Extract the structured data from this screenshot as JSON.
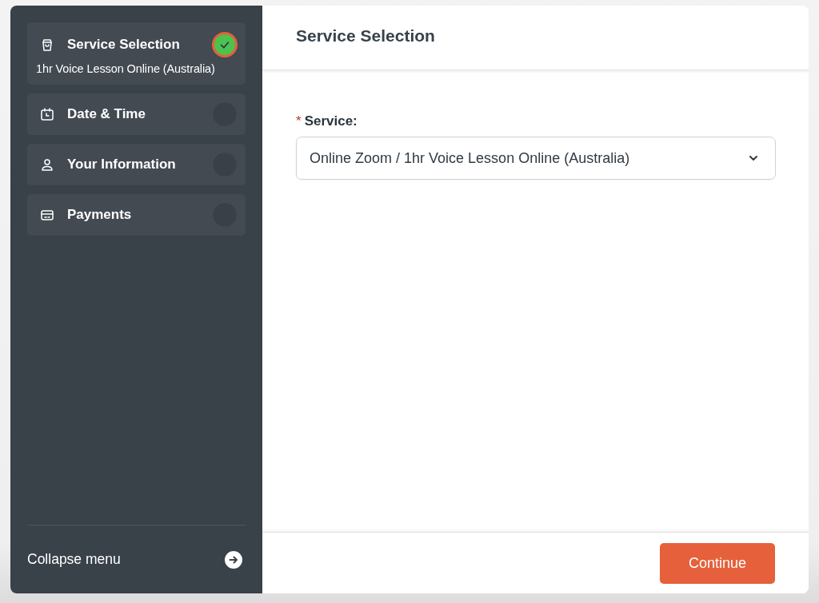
{
  "sidebar": {
    "steps": [
      {
        "label": "Service Selection",
        "detail": "1hr Voice Lesson Online (Australia)",
        "completed": true,
        "current": true
      },
      {
        "label": "Date & Time",
        "completed": false,
        "current": false
      },
      {
        "label": "Your Information",
        "completed": false,
        "current": false
      },
      {
        "label": "Payments",
        "completed": false,
        "current": false
      }
    ],
    "collapse": {
      "label": "Collapse menu"
    }
  },
  "main": {
    "title": "Service Selection",
    "field": {
      "required_mark": "*",
      "label": "Service:",
      "value": "Online Zoom / 1hr Voice Lesson Online (Australia)"
    },
    "footer": {
      "button": "Continue"
    }
  }
}
